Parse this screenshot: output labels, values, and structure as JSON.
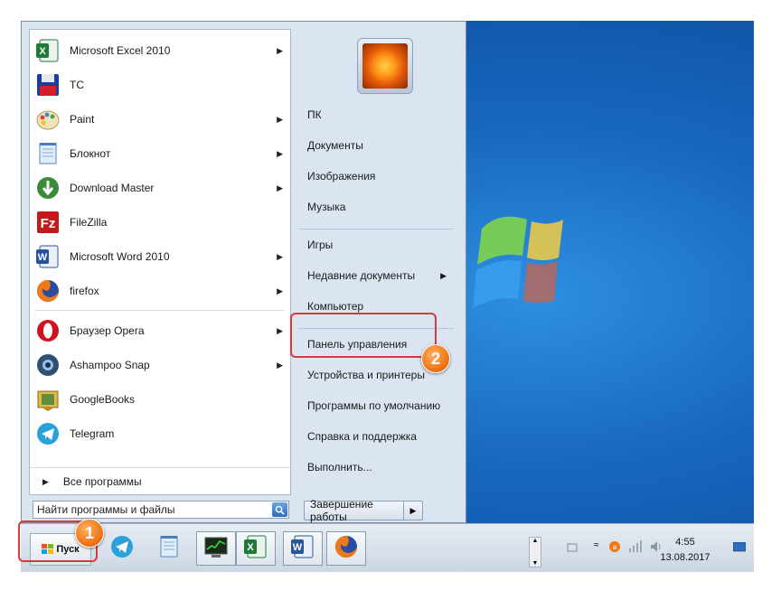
{
  "start_menu": {
    "pinned_programs": [
      {
        "label": "Microsoft Excel 2010",
        "icon": "excel-icon",
        "has_submenu": true
      },
      {
        "label": "TC",
        "icon": "floppy-disk-icon",
        "has_submenu": false
      },
      {
        "label": "Paint",
        "icon": "paint-palette-icon",
        "has_submenu": true
      },
      {
        "label": "Блокнот",
        "icon": "notepad-icon",
        "has_submenu": true
      },
      {
        "label": "Download Master",
        "icon": "download-master-icon",
        "has_submenu": true
      },
      {
        "label": "FileZilla",
        "icon": "filezilla-icon",
        "has_submenu": false
      },
      {
        "label": "Microsoft Word 2010",
        "icon": "word-icon",
        "has_submenu": true
      },
      {
        "label": "firefox",
        "icon": "firefox-icon",
        "has_submenu": true
      }
    ],
    "recent_programs": [
      {
        "label": "Браузер Opera",
        "icon": "opera-icon",
        "has_submenu": true
      },
      {
        "label": "Ashampoo Snap",
        "icon": "ashampoo-snap-icon",
        "has_submenu": true
      },
      {
        "label": "GoogleBooks",
        "icon": "googlebooks-icon",
        "has_submenu": false
      },
      {
        "label": "Telegram",
        "icon": "telegram-icon",
        "has_submenu": false
      }
    ],
    "all_programs_label": "Все программы",
    "search_placeholder": "Найти программы и файлы",
    "right_links": [
      {
        "label": "ПК",
        "group": 1
      },
      {
        "label": "Документы",
        "group": 1
      },
      {
        "label": "Изображения",
        "group": 1
      },
      {
        "label": "Музыка",
        "group": 1
      },
      {
        "label": "Игры",
        "group": 2
      },
      {
        "label": "Недавние документы",
        "group": 2,
        "has_submenu": true
      },
      {
        "label": "Компьютер",
        "group": 2
      },
      {
        "label": "Панель управления",
        "group": 3,
        "highlighted": true
      },
      {
        "label": "Устройства и принтеры",
        "group": 3
      },
      {
        "label": "Программы по умолчанию",
        "group": 3
      },
      {
        "label": "Справка и поддержка",
        "group": 3
      },
      {
        "label": "Выполнить...",
        "group": 3
      }
    ],
    "shutdown_label": "Завершение работы"
  },
  "taskbar": {
    "start_label": "Пуск",
    "pinned": [
      "telegram-icon",
      "notepad-icon",
      "task-manager-icon",
      "excel-icon",
      "word-icon",
      "firefox-icon"
    ],
    "clock_time": "4:55",
    "clock_date": "13.08.2017"
  },
  "annotations": {
    "step1": "1",
    "step2": "2",
    "accent_color": "#d83a3a",
    "badge_color": "#f07818"
  }
}
